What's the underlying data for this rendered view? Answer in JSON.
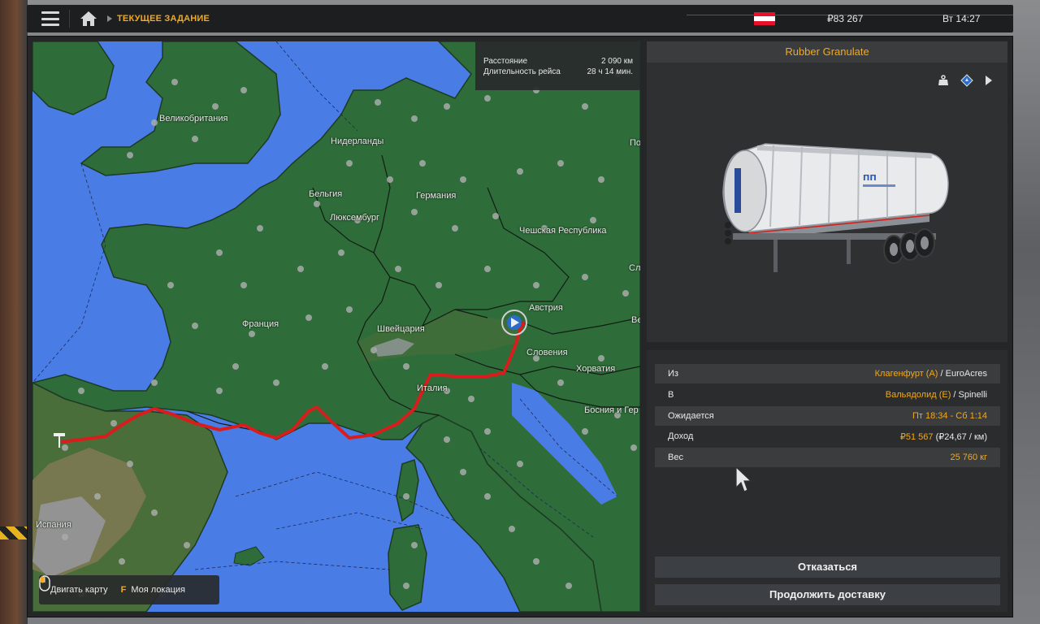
{
  "topbar": {
    "breadcrumb": "ТЕКУЩЕЕ ЗАДАНИЕ",
    "money": "₽83 267",
    "clock": "Вт 14:27",
    "flag_colors": [
      "#e8112d",
      "#ffffff",
      "#e8112d"
    ]
  },
  "map": {
    "info": {
      "distance_label": "Расстояние",
      "distance_value": "2 090 км",
      "duration_label": "Длительность рейса",
      "duration_value": "28 ч 14 мин."
    },
    "labels": {
      "uk": "Великобритания",
      "nl": "Нидерланды",
      "be": "Бельгия",
      "lu": "Люксембург",
      "de": "Германия",
      "cz": "Чешская Республика",
      "fr": "Франция",
      "ch": "Швейцария",
      "at": "Австрия",
      "si": "Словения",
      "hr": "Хорватия",
      "it": "Италия",
      "ba": "Босния и Гер",
      "es": "Испания",
      "pl_partial": "По",
      "sk_partial": "Сл",
      "hu_partial": "Ве"
    },
    "hints": {
      "move_map": "Двигать карту",
      "key": "F",
      "my_location": "Моя локация"
    },
    "colors": {
      "sea": "#4a7ce6",
      "land": "#2e6d3a",
      "route": "#d91c1c"
    }
  },
  "cargo": {
    "name": "Rubber Granulate",
    "icons": [
      "weight-icon",
      "hazard-diamond-icon",
      "play-arrow-icon"
    ]
  },
  "details": {
    "from_label": "Из",
    "from_city": "Клагенфурт (A)",
    "from_company": " / EuroAcres",
    "to_label": "В",
    "to_city": "Вальядолид (E)",
    "to_company": " / Spinelli",
    "expected_label": "Ожидается",
    "expected_value": "Пт 18:34 - Сб 1:14",
    "income_label": "Доход",
    "income_value": "₽51 567",
    "income_rate": " (₽24,67 / км)",
    "weight_label": "Вес",
    "weight_value": "25 760 кг"
  },
  "buttons": {
    "decline": "Отказаться",
    "continue": "Продолжить доставку"
  }
}
